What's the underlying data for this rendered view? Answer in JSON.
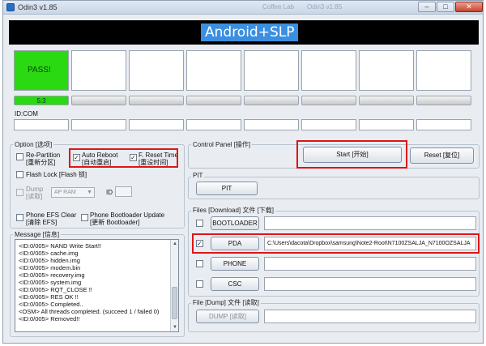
{
  "window": {
    "title": "Odin3 v1.85",
    "background_title_1": "Coffee Lab",
    "background_title_2": "Odin3 v1.85",
    "min_glyph": "–",
    "max_glyph": "□",
    "close_glyph": "✕"
  },
  "banner": {
    "text": "Android+SLP"
  },
  "slots": {
    "pass_text": "PASS!",
    "progress_text": "5:3",
    "idcom_label": "ID:COM"
  },
  "option": {
    "label": "Option [选项]",
    "repartition": [
      "Re-Partition",
      "[重新分区]"
    ],
    "auto_reboot": [
      "Auto Reboot",
      "[自动重启]"
    ],
    "f_reset_time": [
      "F. Reset Time",
      "[重设时间]"
    ],
    "flash_lock": "Flash Lock [Flash 锁]",
    "dump": [
      "Dump",
      "[读取]"
    ],
    "dump_select": "AP RAM",
    "id_label": "ID",
    "phone_efs": [
      "Phone EFS Clear",
      "[清除 EFS]"
    ],
    "phone_bootloader": [
      "Phone Bootloader Update",
      "[更新 Bootloader]"
    ],
    "check_glyph": "✓"
  },
  "message": {
    "label": "Message [信息]",
    "lines": [
      "<ID:0/005> NAND Write Start!!",
      "<ID:0/005> cache.img",
      "<ID:0/005> hidden.img",
      "<ID:0/005> modem.bin",
      "<ID:0/005> recovery.img",
      "<ID:0/005> system.img",
      "<ID:0/005> RQT_CLOSE !!",
      "<ID:0/005> RES OK !!",
      "<ID:0/005> Completed..",
      "<OSM> All threads completed. (succeed 1 / failed 0)",
      "<ID:0/005> Removed!!"
    ]
  },
  "control": {
    "label": "Control Panel [操作]",
    "start": "Start [开始]",
    "reset": "Reset [复位]"
  },
  "pit": {
    "label": "PIT",
    "button": "PIT"
  },
  "files": {
    "label": "Files [Download] 文件 [下载]",
    "bootloader": "BOOTLOADER",
    "pda": "PDA",
    "pda_path": "C:\\Users\\dacota\\Dropbox\\samsung\\Note2-Root\\N7100ZSALJA_N7100OZSALJA",
    "phone": "PHONE",
    "csc": "CSC"
  },
  "dumpfile": {
    "label": "File [Dump] 文件 [读取]",
    "button": "DUMP [读取]"
  }
}
